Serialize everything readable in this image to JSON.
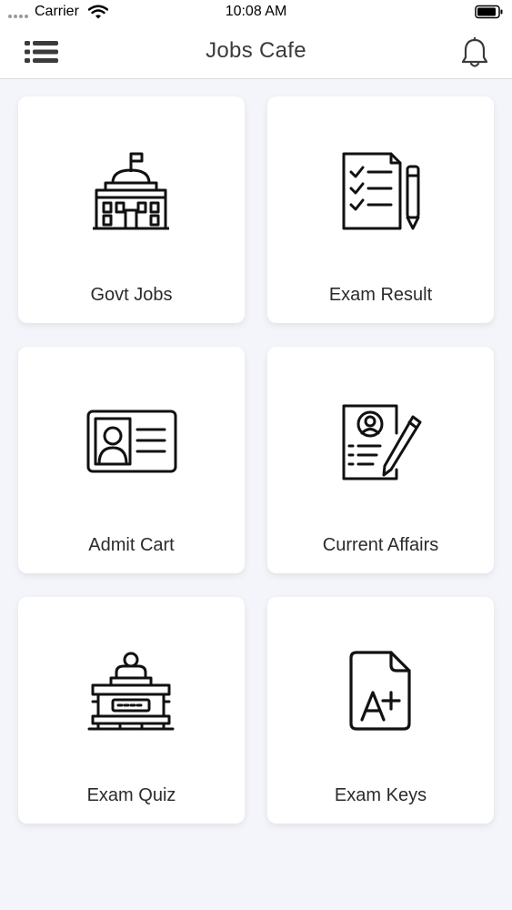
{
  "status_bar": {
    "carrier": "Carrier",
    "time": "10:08 AM",
    "icons": [
      "signal-dots-icon",
      "wifi-icon",
      "battery-icon"
    ]
  },
  "nav": {
    "title": "Jobs Cafe",
    "menu_icon": "menu-list-icon",
    "notification_icon": "bell-icon"
  },
  "cards": [
    {
      "label": "Govt Jobs",
      "icon": "government-building-icon"
    },
    {
      "label": "Exam Result",
      "icon": "checklist-pencil-icon"
    },
    {
      "label": "Admit Cart",
      "icon": "id-card-icon"
    },
    {
      "label": "Current Affairs",
      "icon": "profile-document-pen-icon"
    },
    {
      "label": "Exam Quiz",
      "icon": "podium-speaker-icon"
    },
    {
      "label": "Exam Keys",
      "icon": "grade-a-plus-document-icon"
    }
  ],
  "colors": {
    "background": "#f4f5fa",
    "card": "#ffffff",
    "icon_stroke": "#111111",
    "text": "#2b2b2b"
  }
}
